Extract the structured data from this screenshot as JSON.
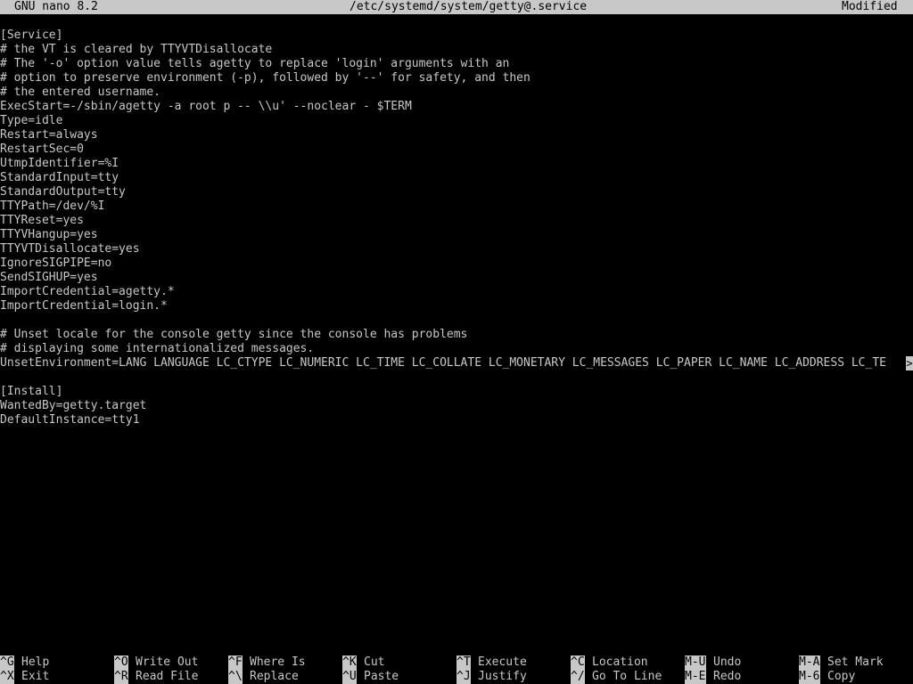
{
  "colors": {
    "background": "#000000",
    "foreground": "#c8c8c8",
    "bar": "#c8c8c8"
  },
  "titlebar": {
    "app": "GNU nano 8.2",
    "file": "/etc/systemd/system/getty@.service",
    "status": "Modified"
  },
  "editor": {
    "lines": [
      "[Service]",
      "# the VT is cleared by TTYVTDisallocate",
      "# The '-o' option value tells agetty to replace 'login' arguments with an",
      "# option to preserve environment (-p), followed by '--' for safety, and then",
      "# the entered username.",
      "ExecStart=-/sbin/agetty -a root p -- \\\\u' --noclear - $TERM",
      "Type=idle",
      "Restart=always",
      "RestartSec=0",
      "UtmpIdentifier=%I",
      "StandardInput=tty",
      "StandardOutput=tty",
      "TTYPath=/dev/%I",
      "TTYReset=yes",
      "TTYVHangup=yes",
      "TTYVTDisallocate=yes",
      "IgnoreSIGPIPE=no",
      "SendSIGHUP=yes",
      "ImportCredential=agetty.*",
      "ImportCredential=login.*",
      "",
      "# Unset locale for the console getty since the console has problems",
      "# displaying some internationalized messages.",
      "UnsetEnvironment=LANG LANGUAGE LC_CTYPE LC_NUMERIC LC_TIME LC_COLLATE LC_MONETARY LC_MESSAGES LC_PAPER LC_NAME LC_ADDRESS LC_TE",
      "",
      "[Install]",
      "WantedBy=getty.target",
      "DefaultInstance=tty1"
    ],
    "overflow_marker": ">"
  },
  "shortcuts": {
    "top": [
      {
        "key": "^G",
        "label": "Help"
      },
      {
        "key": "^O",
        "label": "Write Out"
      },
      {
        "key": "^F",
        "label": "Where Is"
      },
      {
        "key": "^K",
        "label": "Cut"
      },
      {
        "key": "^T",
        "label": "Execute"
      },
      {
        "key": "^C",
        "label": "Location"
      },
      {
        "key": "M-U",
        "label": "Undo"
      },
      {
        "key": "M-A",
        "label": "Set Mark"
      }
    ],
    "bottom": [
      {
        "key": "^X",
        "label": "Exit"
      },
      {
        "key": "^R",
        "label": "Read File"
      },
      {
        "key": "^\\",
        "label": "Replace"
      },
      {
        "key": "^U",
        "label": "Paste"
      },
      {
        "key": "^J",
        "label": "Justify"
      },
      {
        "key": "^/",
        "label": "Go To Line"
      },
      {
        "key": "M-E",
        "label": "Redo"
      },
      {
        "key": "M-6",
        "label": "Copy"
      }
    ]
  }
}
